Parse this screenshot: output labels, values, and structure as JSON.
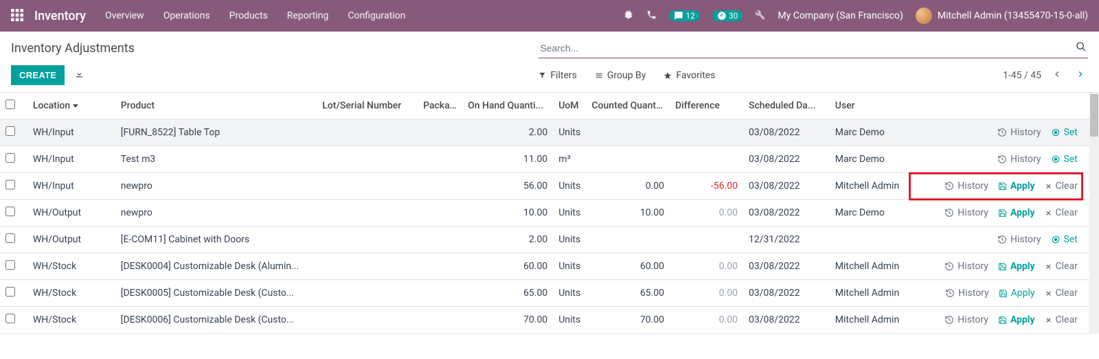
{
  "header": {
    "brand": "Inventory",
    "menu": [
      "Overview",
      "Operations",
      "Products",
      "Reporting",
      "Configuration"
    ],
    "chat_count": "12",
    "activity_count": "30",
    "company": "My Company (San Francisco)",
    "user": "Mitchell Admin (13455470-15-0-all)"
  },
  "cp": {
    "title": "Inventory Adjustments",
    "search_placeholder": "Search...",
    "create": "CREATE",
    "filters": "Filters",
    "groupby": "Group By",
    "favorites": "Favorites",
    "pager": "1-45 / 45"
  },
  "columns": {
    "location": "Location",
    "product": "Product",
    "lot": "Lot/Serial Number",
    "package": "Packa...",
    "onhand": "On Hand Quanti...",
    "uom": "UoM",
    "counted": "Counted Quantity",
    "diff": "Difference",
    "scheduled": "Scheduled Da...",
    "user": "User"
  },
  "labels": {
    "history": "History",
    "set": "Set",
    "apply": "Apply",
    "clear": "Clear"
  },
  "rows": [
    {
      "location": "WH/Input",
      "product": "[FURN_8522] Table Top",
      "onhand": "2.00",
      "uom": "Units",
      "counted": "",
      "diff": "",
      "scheduled": "03/08/2022",
      "user": "Marc Demo",
      "mode": "set",
      "active": true
    },
    {
      "location": "WH/Input",
      "product": "Test m3",
      "onhand": "11.00",
      "uom": "m³",
      "counted": "",
      "diff": "",
      "scheduled": "03/08/2022",
      "user": "Marc Demo",
      "mode": "set"
    },
    {
      "location": "WH/Input",
      "product": "newpro",
      "onhand": "56.00",
      "uom": "Units",
      "counted": "0.00",
      "diff": "-56.00",
      "diff_neg": true,
      "scheduled": "03/08/2022",
      "user": "Mitchell Admin",
      "mode": "apply",
      "bold": true,
      "highlight_actions": true
    },
    {
      "location": "WH/Output",
      "product": "newpro",
      "onhand": "10.00",
      "uom": "Units",
      "counted": "10.00",
      "diff": "0.00",
      "diff_muted": true,
      "scheduled": "03/08/2022",
      "user": "Marc Demo",
      "mode": "apply",
      "bold": true
    },
    {
      "location": "WH/Output",
      "product": "[E-COM11] Cabinet with Doors",
      "onhand": "2.00",
      "uom": "Units",
      "counted": "",
      "diff": "",
      "scheduled": "12/31/2022",
      "user": "",
      "mode": "set"
    },
    {
      "location": "WH/Stock",
      "product": "[DESK0004] Customizable Desk (Alumin...",
      "onhand": "60.00",
      "uom": "Units",
      "counted": "60.00",
      "diff": "0.00",
      "diff_muted": true,
      "scheduled": "03/08/2022",
      "user": "Mitchell Admin",
      "mode": "apply",
      "bold": true
    },
    {
      "location": "WH/Stock",
      "product": "[DESK0005] Customizable Desk (Custo...",
      "onhand": "65.00",
      "uom": "Units",
      "counted": "65.00",
      "diff": "0.00",
      "diff_muted": true,
      "scheduled": "03/08/2022",
      "user": "Mitchell Admin",
      "mode": "apply"
    },
    {
      "location": "WH/Stock",
      "product": "[DESK0006] Customizable Desk (Custo...",
      "onhand": "70.00",
      "uom": "Units",
      "counted": "70.00",
      "diff": "0.00",
      "diff_muted": true,
      "scheduled": "03/08/2022",
      "user": "Mitchell Admin",
      "mode": "apply",
      "bold": true
    }
  ]
}
